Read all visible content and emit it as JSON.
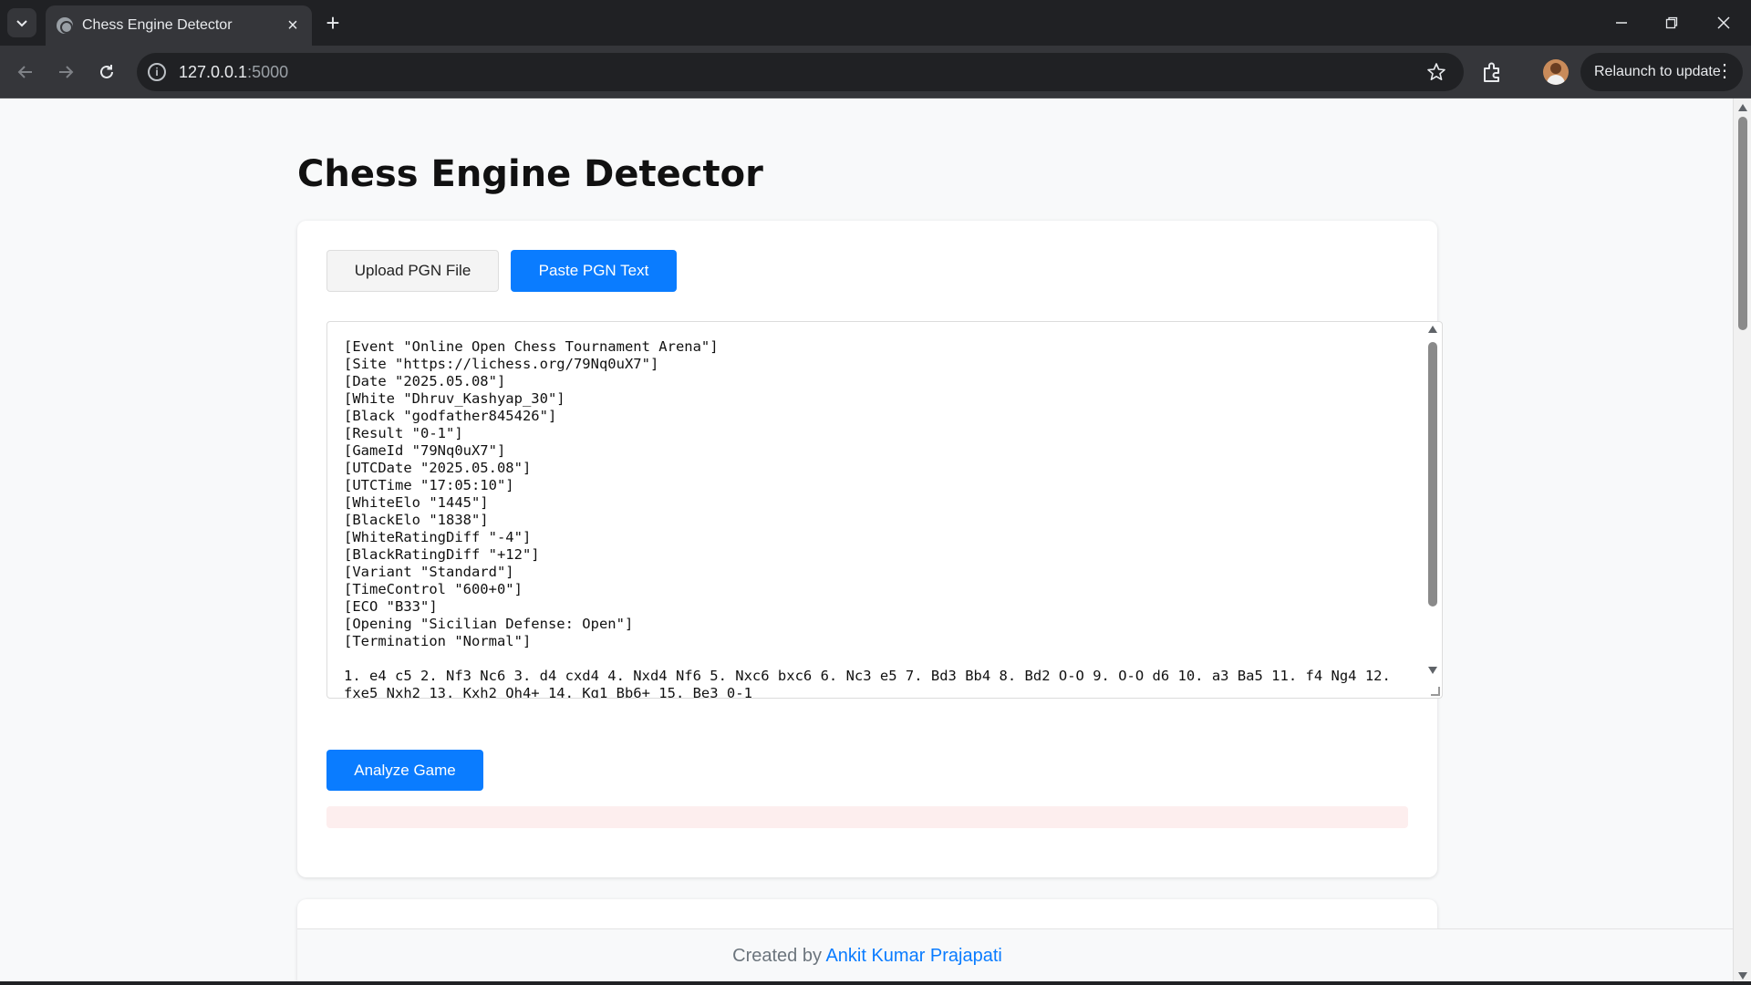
{
  "browser": {
    "tab_title": "Chess Engine Detector",
    "url_host": "127.0.0.1",
    "url_port": ":5000",
    "relaunch_label": "Relaunch to update"
  },
  "page": {
    "title": "Chess Engine Detector",
    "upload_button": "Upload PGN File",
    "paste_button": "Paste PGN Text",
    "pgn_text": "[Event \"Online Open Chess Tournament Arena\"]\n[Site \"https://lichess.org/79Nq0uX7\"]\n[Date \"2025.05.08\"]\n[White \"Dhruv_Kashyap_30\"]\n[Black \"godfather845426\"]\n[Result \"0-1\"]\n[GameId \"79Nq0uX7\"]\n[UTCDate \"2025.05.08\"]\n[UTCTime \"17:05:10\"]\n[WhiteElo \"1445\"]\n[BlackElo \"1838\"]\n[WhiteRatingDiff \"-4\"]\n[BlackRatingDiff \"+12\"]\n[Variant \"Standard\"]\n[TimeControl \"600+0\"]\n[ECO \"B33\"]\n[Opening \"Sicilian Defense: Open\"]\n[Termination \"Normal\"]\n\n1. e4 c5 2. Nf3 Nc6 3. d4 cxd4 4. Nxd4 Nf6 5. Nxc6 bxc6 6. Nc3 e5 7. Bd3 Bb4 8. Bd2 O-O 9. O-O d6 10. a3 Ba5 11. f4 Ng4 12. fxe5 Nxh2 13. Kxh2 Qh4+ 14. Kg1 Bb6+ 15. Be3 0-1",
    "analyze_button": "Analyze Game"
  },
  "footer": {
    "prefix": "Created by ",
    "author": "Ankit Kumar Prajapati"
  },
  "colors": {
    "accent": "#0a7cff",
    "error_bg": "#fdeeee"
  }
}
